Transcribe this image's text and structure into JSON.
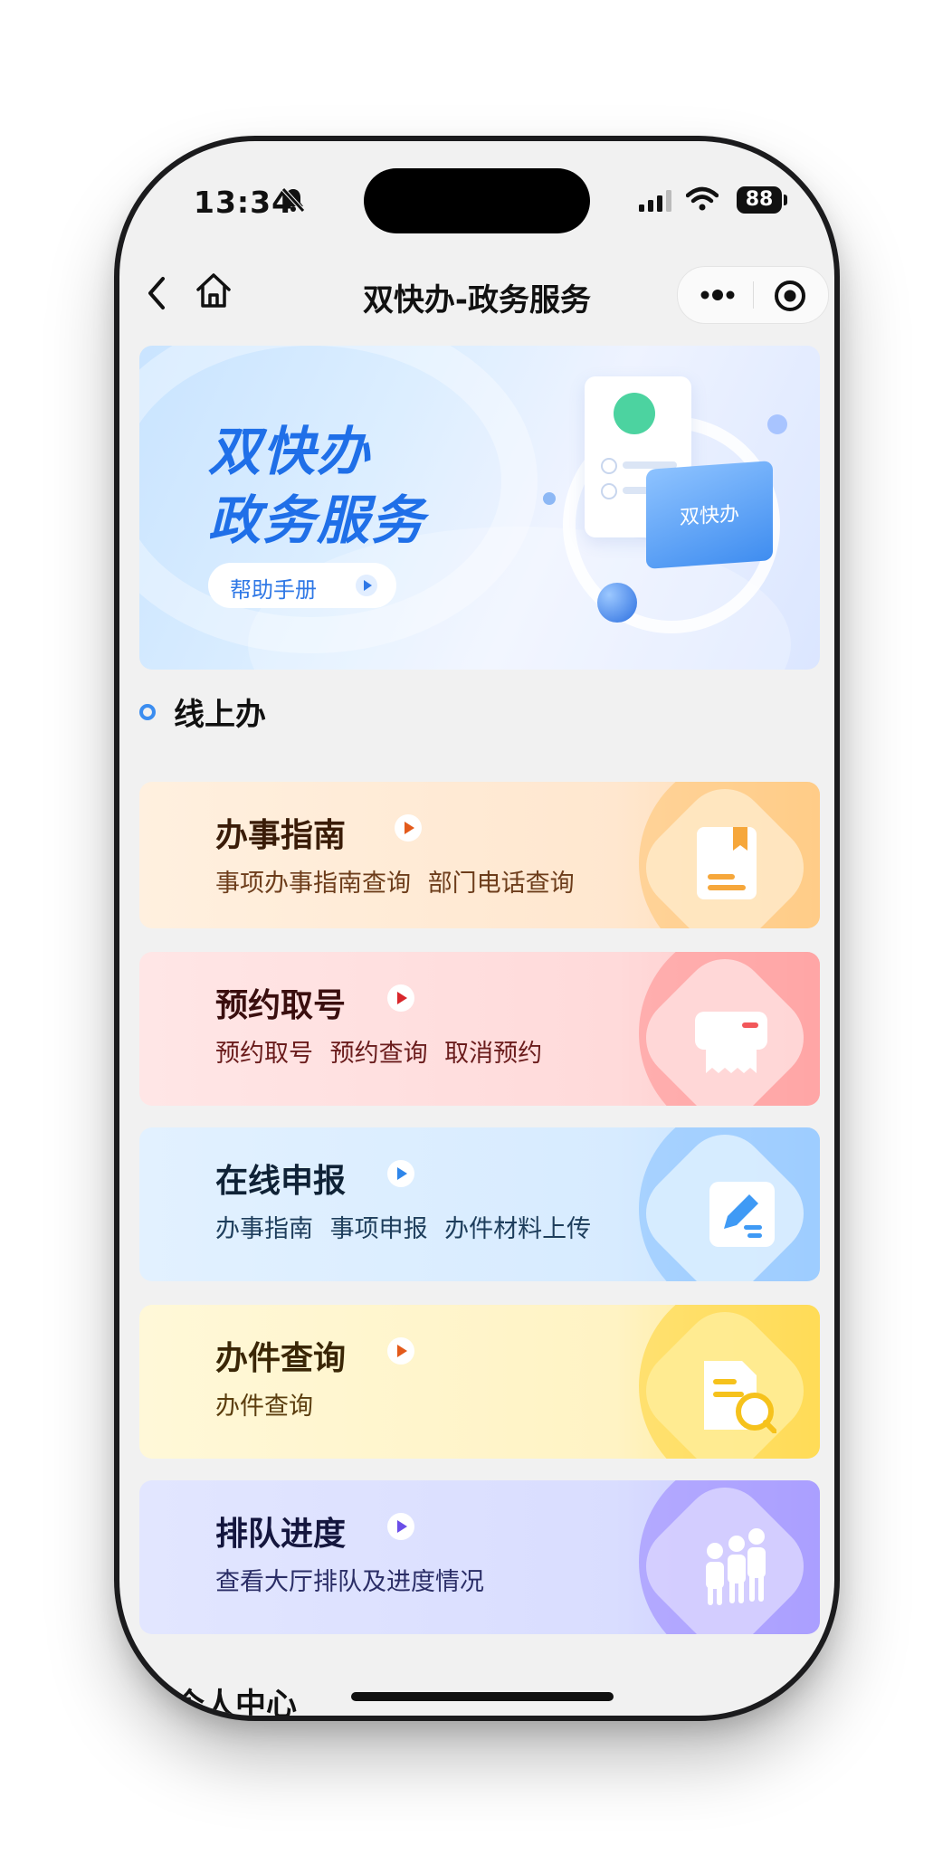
{
  "status_bar": {
    "time": "13:34",
    "battery": "88"
  },
  "nav": {
    "title": "双快办-政务服务"
  },
  "banner": {
    "title_line1": "双快办",
    "title_line2": "政务服务",
    "help_button": "帮助手册",
    "board_label": "双快办"
  },
  "section_online": {
    "title": "线上办"
  },
  "services": [
    {
      "title": "办事指南",
      "subtitle": "事项办事指南查询 部门电话查询",
      "icon": "book-icon",
      "accent": "#f6a73b"
    },
    {
      "title": "预约取号",
      "subtitle": "预约取号  预约查询  取消预约",
      "icon": "ticket-printer-icon",
      "accent": "#f2575a"
    },
    {
      "title": "在线申报",
      "subtitle": "办事指南  事项申报  办件材料上传",
      "icon": "edit-document-icon",
      "accent": "#3f9af5"
    },
    {
      "title": "办件查询",
      "subtitle": "办件查询",
      "icon": "document-search-icon",
      "accent": "#f6c21c"
    },
    {
      "title": "排队进度",
      "subtitle": "查看大厅排队及进度情况",
      "icon": "queue-people-icon",
      "accent": "#8a6cf5"
    }
  ],
  "section_personal": {
    "title": "个人中心"
  }
}
